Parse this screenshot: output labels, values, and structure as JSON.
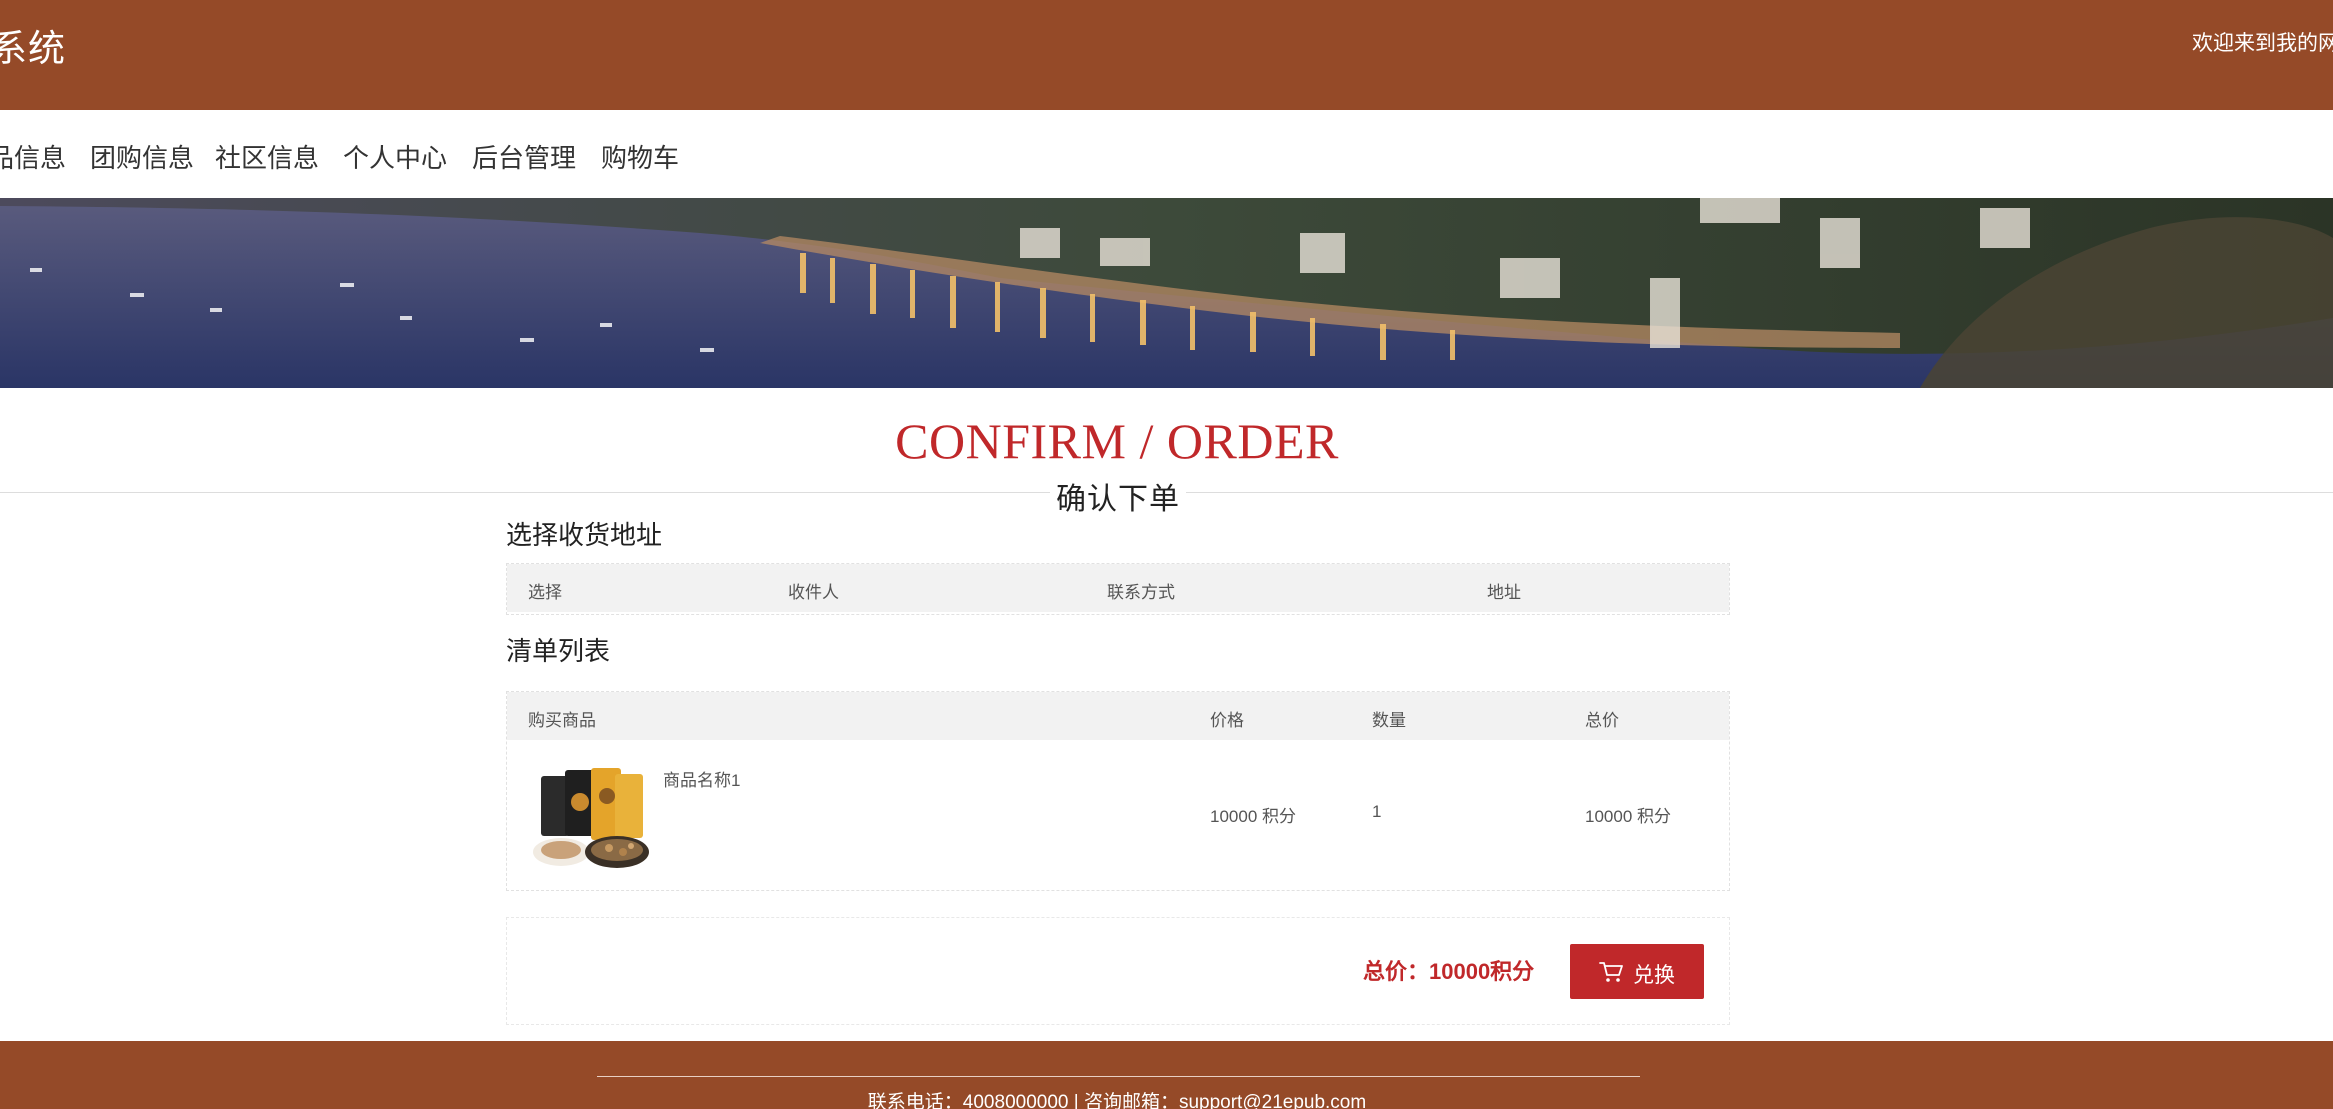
{
  "header": {
    "site_title": "购系统",
    "welcome": "欢迎来到我的网"
  },
  "nav": {
    "items": [
      "品信息",
      "团购信息",
      "社区信息",
      "个人中心",
      "后台管理",
      "购物车"
    ]
  },
  "page": {
    "title_en": "CONFIRM / ORDER",
    "title_cn": "确认下单"
  },
  "address": {
    "heading": "选择收货地址",
    "columns": [
      "选择",
      "收件人",
      "联系方式",
      "地址"
    ]
  },
  "order": {
    "heading": "清单列表",
    "columns": [
      "购买商品",
      "价格",
      "数量",
      "总价"
    ],
    "items": [
      {
        "name": "商品名称1",
        "price": "10000 积分",
        "quantity": "1",
        "subtotal": "10000 积分"
      }
    ]
  },
  "summary": {
    "total_text": "总价：10000积分",
    "exchange_label": "兑换",
    "exchange_icon": "cart-icon"
  },
  "footer": {
    "contact": "联系电话：4008000000 | 咨询邮箱：support@21epub.com"
  },
  "colors": {
    "brand": "#954a28",
    "accent": "#c0282a"
  }
}
